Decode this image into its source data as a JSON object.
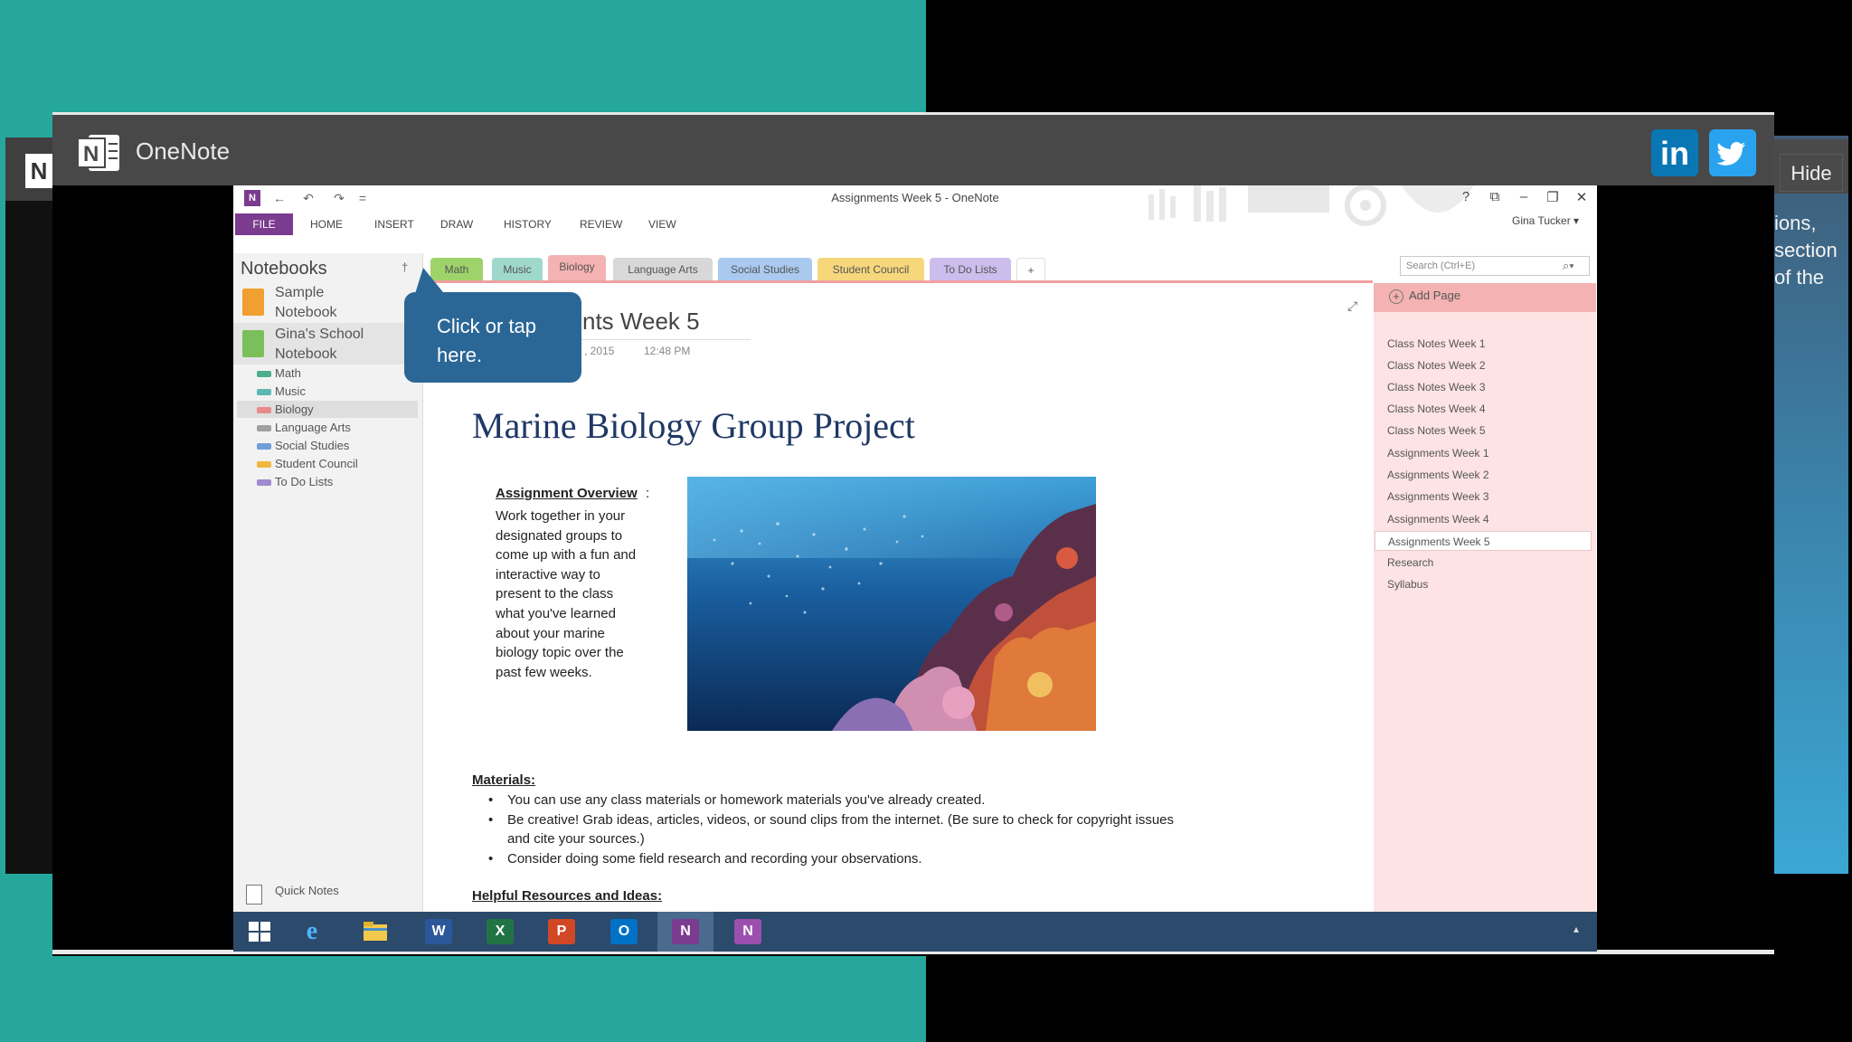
{
  "app": {
    "title": "OneNote",
    "hide_label": "Hide",
    "side_text": [
      "ions,",
      "section",
      "of the"
    ]
  },
  "social": {
    "linkedin_label": "in",
    "twitter_icon": "twitter-bird-icon"
  },
  "window": {
    "title": "Assignments Week 5 - OneNote",
    "user": "Gina Tucker",
    "user_caret": "▾",
    "controls": [
      "?",
      "⧉",
      "–",
      "❐",
      "✕"
    ]
  },
  "quick_access": {
    "app_letter": "N",
    "back": "←",
    "undo": "↶",
    "redo": "↷",
    "more": "="
  },
  "ribbon": {
    "tabs": [
      "FILE",
      "HOME",
      "INSERT",
      "DRAW",
      "HISTORY",
      "REVIEW",
      "VIEW"
    ]
  },
  "notebooks": {
    "heading": "Notebooks",
    "pin": "†",
    "items": [
      {
        "line1": "Sample",
        "line2": "Notebook",
        "color": "#f0a030"
      },
      {
        "line1": "Gina's School",
        "line2": "Notebook",
        "color": "#7bbf5a"
      }
    ],
    "sections": [
      {
        "label": "Math",
        "color": "#4cae8a"
      },
      {
        "label": "Music",
        "color": "#5cb8b0"
      },
      {
        "label": "Biology",
        "color": "#e98a8a"
      },
      {
        "label": "Language Arts",
        "color": "#a0a0a0"
      },
      {
        "label": "Social Studies",
        "color": "#6f9fd8"
      },
      {
        "label": "Student Council",
        "color": "#f0b840"
      },
      {
        "label": "To Do Lists",
        "color": "#a08ad0"
      }
    ],
    "quick_notes": "Quick Notes"
  },
  "section_tabs": [
    {
      "label": "Math",
      "color": "#9ed36a"
    },
    {
      "label": "Music",
      "color": "#9fd9cc"
    },
    {
      "label": "Biology",
      "color": "#f4b2b2"
    },
    {
      "label": "Language Arts",
      "color": "#d8d8d8"
    },
    {
      "label": "Social Studies",
      "color": "#a9c9ef"
    },
    {
      "label": "Student Council",
      "color": "#f7d77b"
    },
    {
      "label": "To Do Lists",
      "color": "#cdbdec"
    },
    {
      "label": "+",
      "color": "#ffffff"
    }
  ],
  "search": {
    "placeholder": "Search (Ctrl+E)"
  },
  "callout": {
    "line1": "Click or tap",
    "line2": "here."
  },
  "page": {
    "title": "nts Week 5",
    "date": ", 2015",
    "time": "12:48 PM",
    "heading": "Marine Biology Group Project",
    "overview_head": "Assignment Overview",
    "overview_colon": ":",
    "overview_lines": [
      "Work together in your",
      "designated groups to",
      "come up with a fun and",
      "interactive way to",
      "present to the class",
      "what you've learned",
      "about your marine",
      "biology topic over the",
      "past few weeks."
    ],
    "materials_head": "Materials:",
    "materials": [
      "You can use any class materials or homework materials you've already created.",
      "Be creative! Grab ideas, articles, videos, or sound clips from the internet. (Be sure to check for copyright issues and cite your sources.)",
      "Consider doing some field research and recording your observations."
    ],
    "helpful_head": "Helpful Resources and Ideas:"
  },
  "pages": {
    "add_label": "Add Page",
    "list": [
      "Class Notes Week 1",
      "Class Notes Week 2",
      "Class Notes Week 3",
      "Class Notes Week 4",
      "Class Notes Week 5",
      "Assignments Week 1",
      "Assignments Week 2",
      "Assignments Week 3",
      "Assignments Week 4",
      "Assignments Week 5",
      "Research",
      "Syllabus"
    ],
    "active_index": 9
  },
  "taskbar": {
    "icons": [
      {
        "name": "windows-start-icon",
        "label": "",
        "color": "#2c4a6b"
      },
      {
        "name": "internet-explorer-icon",
        "label": "e",
        "color": "#1e88d8"
      },
      {
        "name": "file-explorer-icon",
        "label": "",
        "color": "#f2c94c"
      },
      {
        "name": "word-icon",
        "label": "W",
        "color": "#2b579a"
      },
      {
        "name": "excel-icon",
        "label": "X",
        "color": "#217346"
      },
      {
        "name": "powerpoint-icon",
        "label": "P",
        "color": "#d24726"
      },
      {
        "name": "outlook-icon",
        "label": "O",
        "color": "#0072c6"
      },
      {
        "name": "onenote-icon",
        "label": "N",
        "color": "#7b3b8e"
      },
      {
        "name": "onenote-clipper-icon",
        "label": "N",
        "color": "#9b4fae"
      }
    ],
    "tray": "▴"
  }
}
